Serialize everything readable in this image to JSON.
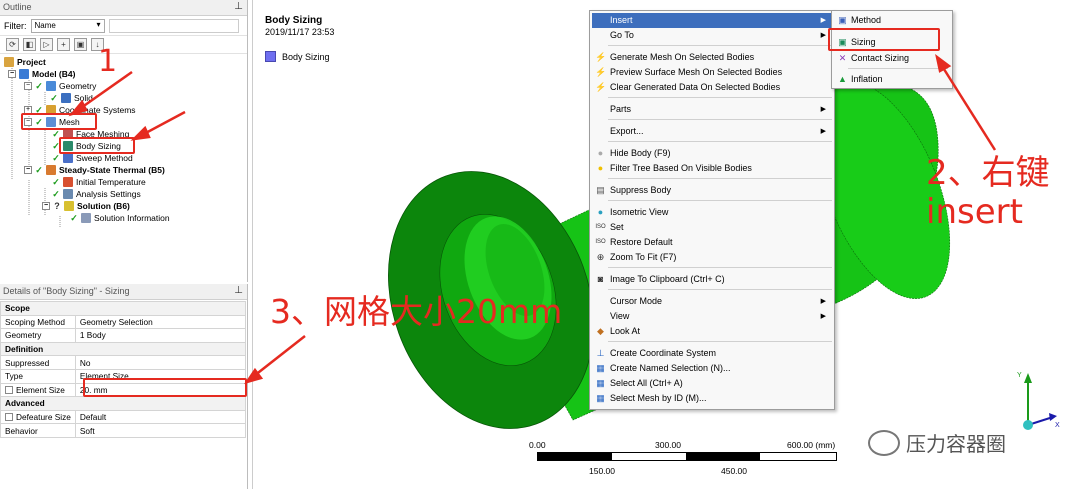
{
  "outline": {
    "title": "Outline",
    "pin": "ᵖ",
    "filter_label": "Filter:",
    "filter_value": "Name",
    "tree": [
      {
        "label": "Project",
        "bold": true
      },
      {
        "label": "Model (B4)",
        "bold": true
      },
      {
        "label": "Geometry",
        "bold": false
      },
      {
        "label": "Solid",
        "bold": false
      },
      {
        "label": "Coordinate Systems",
        "bold": false
      },
      {
        "label": "Mesh",
        "bold": false
      },
      {
        "label": "Face Meshing",
        "bold": false
      },
      {
        "label": "Body Sizing",
        "bold": false
      },
      {
        "label": "Sweep Method",
        "bold": false
      },
      {
        "label": "Steady-State Thermal (B5)",
        "bold": true
      },
      {
        "label": "Initial Temperature",
        "bold": false
      },
      {
        "label": "Analysis Settings",
        "bold": false
      },
      {
        "label": "Solution (B6)",
        "bold": true
      },
      {
        "label": "Solution Information",
        "bold": false
      }
    ]
  },
  "details": {
    "title": "Details of \"Body Sizing\" - Sizing",
    "pin": "ᵖ",
    "rows": [
      {
        "type": "group",
        "key": "Scope",
        "value": ""
      },
      {
        "type": "row",
        "key": "Scoping Method",
        "value": "Geometry Selection"
      },
      {
        "type": "row",
        "key": "Geometry",
        "value": "1 Body"
      },
      {
        "type": "group",
        "key": "Definition",
        "value": ""
      },
      {
        "type": "row",
        "key": "Suppressed",
        "value": "No"
      },
      {
        "type": "row",
        "key": "Type",
        "value": "Element Size"
      },
      {
        "type": "check",
        "key": "Element Size",
        "value": "20. mm"
      },
      {
        "type": "group",
        "key": "Advanced",
        "value": ""
      },
      {
        "type": "check",
        "key": "Defeature Size",
        "value": "Default"
      },
      {
        "type": "row",
        "key": "Behavior",
        "value": "Soft"
      }
    ]
  },
  "viewport": {
    "title": "Body Sizing",
    "date": "2019/11/17 23:53",
    "legend_label": "Body Sizing",
    "legend_color": "#6f6ff0",
    "scale_top": [
      "0.00",
      "300.00",
      "600.00 (mm)"
    ],
    "scale_bottom": [
      "150.00",
      "450.00"
    ],
    "body_color": "#17c717",
    "body_dark": "#0e7d0e"
  },
  "context_menu": [
    {
      "label": "Insert",
      "submenu": true,
      "highlight": true,
      "icon": ""
    },
    {
      "label": "Go To",
      "submenu": true,
      "icon": ""
    },
    {
      "sep": true
    },
    {
      "label": "Generate Mesh On Selected Bodies",
      "icon": "lightning-icon"
    },
    {
      "label": "Preview Surface Mesh On Selected Bodies",
      "icon": "lightning-icon"
    },
    {
      "label": "Clear Generated Data On Selected Bodies",
      "icon": "lightning-icon"
    },
    {
      "sep": true
    },
    {
      "label": "Parts",
      "submenu": true,
      "icon": ""
    },
    {
      "sep": true
    },
    {
      "label": "Export...",
      "submenu": true,
      "icon": ""
    },
    {
      "sep": true
    },
    {
      "label": "Hide Body (F9)",
      "icon": "bulb-icon"
    },
    {
      "label": "Filter Tree Based On Visible Bodies",
      "icon": "bulb-icon"
    },
    {
      "sep": true
    },
    {
      "label": "Suppress Body",
      "icon": "suppress-icon"
    },
    {
      "sep": true
    },
    {
      "label": "Isometric View",
      "icon": "globe-icon"
    },
    {
      "label": "Set",
      "icon": "iso-icon"
    },
    {
      "label": "Restore Default",
      "icon": "iso-icon"
    },
    {
      "label": "Zoom To Fit (F7)",
      "icon": "zoom-icon"
    },
    {
      "sep": true
    },
    {
      "label": "Image To Clipboard (Ctrl+ C)",
      "icon": "camera-icon"
    },
    {
      "sep": true
    },
    {
      "label": "Cursor Mode",
      "submenu": true,
      "icon": ""
    },
    {
      "label": "View",
      "submenu": true,
      "icon": ""
    },
    {
      "label": "Look At",
      "icon": "look-icon"
    },
    {
      "sep": true
    },
    {
      "label": "Create Coordinate System",
      "icon": "axis-icon"
    },
    {
      "label": "Create Named Selection (N)...",
      "icon": "named-icon"
    },
    {
      "label": "Select All (Ctrl+ A)",
      "icon": "select-icon"
    },
    {
      "label": "Select Mesh by ID (M)...",
      "icon": "mesh-icon"
    }
  ],
  "submenu": [
    {
      "label": "Method",
      "icon": "method-icon"
    },
    {
      "label": "Sizing",
      "icon": "sizing-icon"
    },
    {
      "label": "Contact Sizing",
      "icon": "contact-icon"
    },
    {
      "label": "Inflation",
      "icon": "inflation-icon"
    }
  ],
  "annotations": {
    "step1": "1",
    "step2_line1": "2、右键",
    "step2_line2": "insert",
    "step3": "3、网格大小20mm",
    "accent": "#e52a20"
  },
  "watermark": "压力容器圈"
}
